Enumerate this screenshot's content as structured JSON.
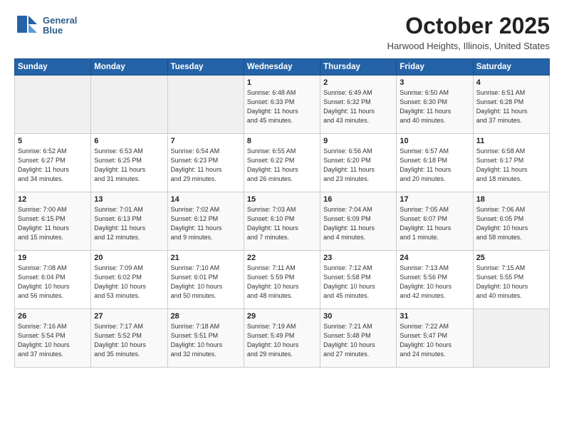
{
  "logo": {
    "line1": "General",
    "line2": "Blue"
  },
  "title": "October 2025",
  "subtitle": "Harwood Heights, Illinois, United States",
  "header_days": [
    "Sunday",
    "Monday",
    "Tuesday",
    "Wednesday",
    "Thursday",
    "Friday",
    "Saturday"
  ],
  "weeks": [
    [
      {
        "day": "",
        "info": ""
      },
      {
        "day": "",
        "info": ""
      },
      {
        "day": "",
        "info": ""
      },
      {
        "day": "1",
        "info": "Sunrise: 6:48 AM\nSunset: 6:33 PM\nDaylight: 11 hours\nand 45 minutes."
      },
      {
        "day": "2",
        "info": "Sunrise: 6:49 AM\nSunset: 6:32 PM\nDaylight: 11 hours\nand 43 minutes."
      },
      {
        "day": "3",
        "info": "Sunrise: 6:50 AM\nSunset: 6:30 PM\nDaylight: 11 hours\nand 40 minutes."
      },
      {
        "day": "4",
        "info": "Sunrise: 6:51 AM\nSunset: 6:28 PM\nDaylight: 11 hours\nand 37 minutes."
      }
    ],
    [
      {
        "day": "5",
        "info": "Sunrise: 6:52 AM\nSunset: 6:27 PM\nDaylight: 11 hours\nand 34 minutes."
      },
      {
        "day": "6",
        "info": "Sunrise: 6:53 AM\nSunset: 6:25 PM\nDaylight: 11 hours\nand 31 minutes."
      },
      {
        "day": "7",
        "info": "Sunrise: 6:54 AM\nSunset: 6:23 PM\nDaylight: 11 hours\nand 29 minutes."
      },
      {
        "day": "8",
        "info": "Sunrise: 6:55 AM\nSunset: 6:22 PM\nDaylight: 11 hours\nand 26 minutes."
      },
      {
        "day": "9",
        "info": "Sunrise: 6:56 AM\nSunset: 6:20 PM\nDaylight: 11 hours\nand 23 minutes."
      },
      {
        "day": "10",
        "info": "Sunrise: 6:57 AM\nSunset: 6:18 PM\nDaylight: 11 hours\nand 20 minutes."
      },
      {
        "day": "11",
        "info": "Sunrise: 6:58 AM\nSunset: 6:17 PM\nDaylight: 11 hours\nand 18 minutes."
      }
    ],
    [
      {
        "day": "12",
        "info": "Sunrise: 7:00 AM\nSunset: 6:15 PM\nDaylight: 11 hours\nand 15 minutes."
      },
      {
        "day": "13",
        "info": "Sunrise: 7:01 AM\nSunset: 6:13 PM\nDaylight: 11 hours\nand 12 minutes."
      },
      {
        "day": "14",
        "info": "Sunrise: 7:02 AM\nSunset: 6:12 PM\nDaylight: 11 hours\nand 9 minutes."
      },
      {
        "day": "15",
        "info": "Sunrise: 7:03 AM\nSunset: 6:10 PM\nDaylight: 11 hours\nand 7 minutes."
      },
      {
        "day": "16",
        "info": "Sunrise: 7:04 AM\nSunset: 6:09 PM\nDaylight: 11 hours\nand 4 minutes."
      },
      {
        "day": "17",
        "info": "Sunrise: 7:05 AM\nSunset: 6:07 PM\nDaylight: 11 hours\nand 1 minute."
      },
      {
        "day": "18",
        "info": "Sunrise: 7:06 AM\nSunset: 6:05 PM\nDaylight: 10 hours\nand 58 minutes."
      }
    ],
    [
      {
        "day": "19",
        "info": "Sunrise: 7:08 AM\nSunset: 6:04 PM\nDaylight: 10 hours\nand 56 minutes."
      },
      {
        "day": "20",
        "info": "Sunrise: 7:09 AM\nSunset: 6:02 PM\nDaylight: 10 hours\nand 53 minutes."
      },
      {
        "day": "21",
        "info": "Sunrise: 7:10 AM\nSunset: 6:01 PM\nDaylight: 10 hours\nand 50 minutes."
      },
      {
        "day": "22",
        "info": "Sunrise: 7:11 AM\nSunset: 5:59 PM\nDaylight: 10 hours\nand 48 minutes."
      },
      {
        "day": "23",
        "info": "Sunrise: 7:12 AM\nSunset: 5:58 PM\nDaylight: 10 hours\nand 45 minutes."
      },
      {
        "day": "24",
        "info": "Sunrise: 7:13 AM\nSunset: 5:56 PM\nDaylight: 10 hours\nand 42 minutes."
      },
      {
        "day": "25",
        "info": "Sunrise: 7:15 AM\nSunset: 5:55 PM\nDaylight: 10 hours\nand 40 minutes."
      }
    ],
    [
      {
        "day": "26",
        "info": "Sunrise: 7:16 AM\nSunset: 5:54 PM\nDaylight: 10 hours\nand 37 minutes."
      },
      {
        "day": "27",
        "info": "Sunrise: 7:17 AM\nSunset: 5:52 PM\nDaylight: 10 hours\nand 35 minutes."
      },
      {
        "day": "28",
        "info": "Sunrise: 7:18 AM\nSunset: 5:51 PM\nDaylight: 10 hours\nand 32 minutes."
      },
      {
        "day": "29",
        "info": "Sunrise: 7:19 AM\nSunset: 5:49 PM\nDaylight: 10 hours\nand 29 minutes."
      },
      {
        "day": "30",
        "info": "Sunrise: 7:21 AM\nSunset: 5:48 PM\nDaylight: 10 hours\nand 27 minutes."
      },
      {
        "day": "31",
        "info": "Sunrise: 7:22 AM\nSunset: 5:47 PM\nDaylight: 10 hours\nand 24 minutes."
      },
      {
        "day": "",
        "info": ""
      }
    ]
  ]
}
